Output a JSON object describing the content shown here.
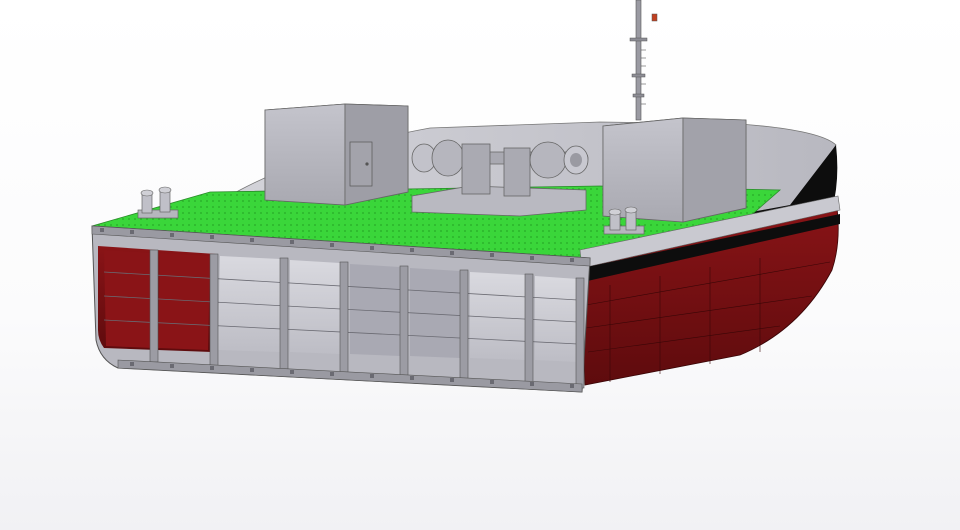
{
  "scene": {
    "subject": "barge-hull-section-cad-model",
    "colors": {
      "background_top": "#ffffff",
      "background_bottom": "#eeeef2",
      "deck_green": "#33d433",
      "hull_red": "#7a1012",
      "hull_black": "#0d0d0d",
      "structure_grey": "#c8c8d0",
      "machinery_grey": "#b4b4bc"
    },
    "icons": [
      "mast",
      "deckhouse-block",
      "anchor-windlass",
      "bollard",
      "hull-frames"
    ]
  }
}
